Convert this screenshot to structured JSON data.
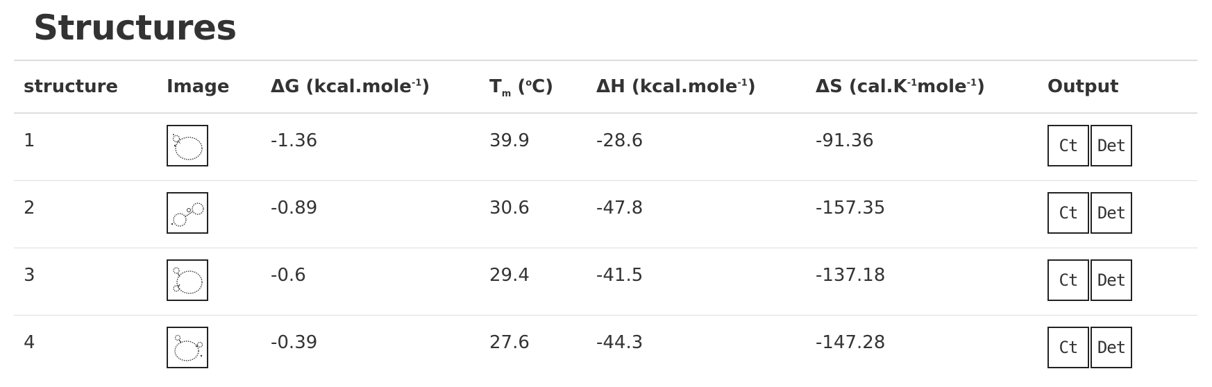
{
  "page": {
    "title": "Structures"
  },
  "table": {
    "headers": {
      "structure": "structure",
      "image": "Image",
      "dg_main": "ΔG (kcal.mole",
      "dg_sup": "-1",
      "dg_end": ")",
      "tm_main": "T",
      "tm_sub": "m",
      "tm_mid": " (",
      "tm_sup": "o",
      "tm_end": "C)",
      "dh_main": "ΔH (kcal.mole",
      "dh_sup": "-1",
      "dh_end": ")",
      "ds_main": "ΔS (cal.K",
      "ds_sup1": "-1",
      "ds_mid": "mole",
      "ds_sup2": "-1",
      "ds_end": ")",
      "output": "Output"
    },
    "rows": [
      {
        "structure": "1",
        "dg": "-1.36",
        "tm": "39.9",
        "dh": "-28.6",
        "ds": "-91.36",
        "ct_label": "Ct",
        "det_label": "Det",
        "image_icon": "rna-structure-1-thumbnail"
      },
      {
        "structure": "2",
        "dg": "-0.89",
        "tm": "30.6",
        "dh": "-47.8",
        "ds": "-157.35",
        "ct_label": "Ct",
        "det_label": "Det",
        "image_icon": "rna-structure-2-thumbnail"
      },
      {
        "structure": "3",
        "dg": "-0.6",
        "tm": "29.4",
        "dh": "-41.5",
        "ds": "-137.18",
        "ct_label": "Ct",
        "det_label": "Det",
        "image_icon": "rna-structure-3-thumbnail"
      },
      {
        "structure": "4",
        "dg": "-0.39",
        "tm": "27.6",
        "dh": "-44.3",
        "ds": "-147.28",
        "ct_label": "Ct",
        "det_label": "Det",
        "image_icon": "rna-structure-4-thumbnail"
      }
    ]
  }
}
